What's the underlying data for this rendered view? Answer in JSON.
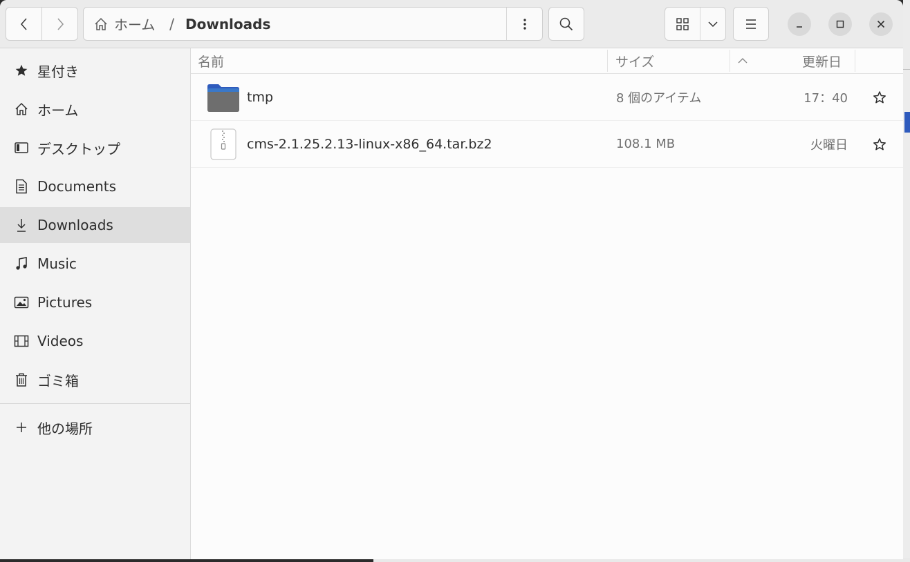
{
  "path": {
    "home_label": "ホーム",
    "separator": "/",
    "current": "Downloads"
  },
  "columns": {
    "name": "名前",
    "size": "サイズ",
    "modified": "更新日"
  },
  "sidebar": {
    "items": [
      {
        "label": "星付き",
        "icon": "star-icon"
      },
      {
        "label": "ホーム",
        "icon": "home-icon"
      },
      {
        "label": "デスクトップ",
        "icon": "desktop-icon"
      },
      {
        "label": "Documents",
        "icon": "document-icon"
      },
      {
        "label": "Downloads",
        "icon": "download-icon",
        "active": true
      },
      {
        "label": "Music",
        "icon": "music-icon"
      },
      {
        "label": "Pictures",
        "icon": "picture-icon"
      },
      {
        "label": "Videos",
        "icon": "video-icon"
      },
      {
        "label": "ゴミ箱",
        "icon": "trash-icon"
      }
    ],
    "other_locations": {
      "label": "他の場所",
      "icon": "plus-icon"
    }
  },
  "files": [
    {
      "name": "tmp",
      "size": "8 個のアイテム",
      "modified": "17：40",
      "type": "folder",
      "icon": "folder-icon"
    },
    {
      "name": "cms-2.1.25.2.13-linux-x86_64.tar.bz2",
      "size": "108.1 MB",
      "modified": "火曜日",
      "type": "archive",
      "icon": "archive-icon"
    }
  ],
  "colors": {
    "folder": "#3a78c9",
    "selection": "#dedede",
    "accent": "#2f5bbd"
  }
}
